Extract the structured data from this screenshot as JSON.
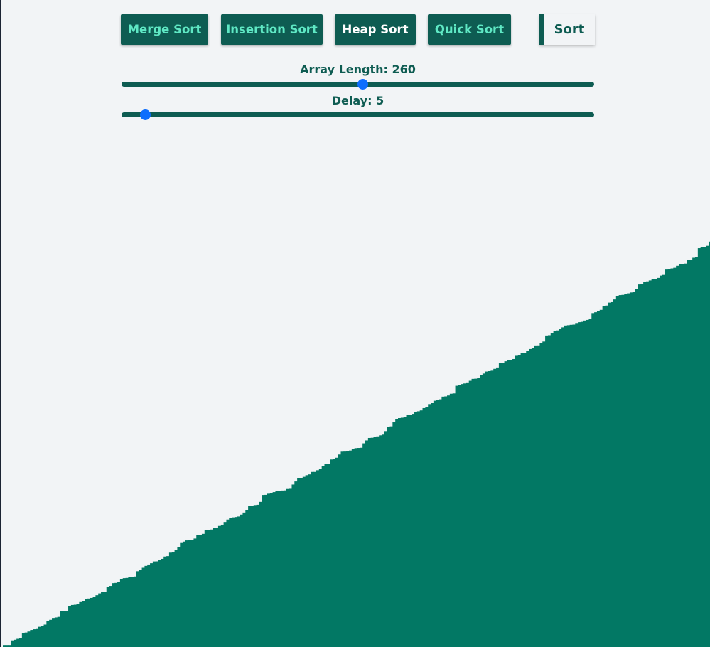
{
  "toolbar": {
    "algorithms": [
      {
        "label": "Merge Sort",
        "selected": false
      },
      {
        "label": "Insertion Sort",
        "selected": false
      },
      {
        "label": "Heap Sort",
        "selected": true
      },
      {
        "label": "Quick Sort",
        "selected": false
      }
    ],
    "sort_label": "Sort"
  },
  "controls": {
    "array_length_label": "Array Length: 260",
    "array_length": {
      "value": 260,
      "fraction": 0.51
    },
    "delay_label": "Delay: 5",
    "delay": {
      "value": 5,
      "fraction": 0.05
    }
  },
  "colors": {
    "primary": "#0e5c52",
    "bar": "#027864",
    "button_text": "#5fe8c4",
    "selected_text": "#ffffff",
    "thumb": "#0d6efd",
    "background": "#f2f4f6"
  },
  "visualization": {
    "bar_count": 260,
    "state": "sorted ascending",
    "min_fraction": 0.0,
    "max_fraction": 0.62
  }
}
